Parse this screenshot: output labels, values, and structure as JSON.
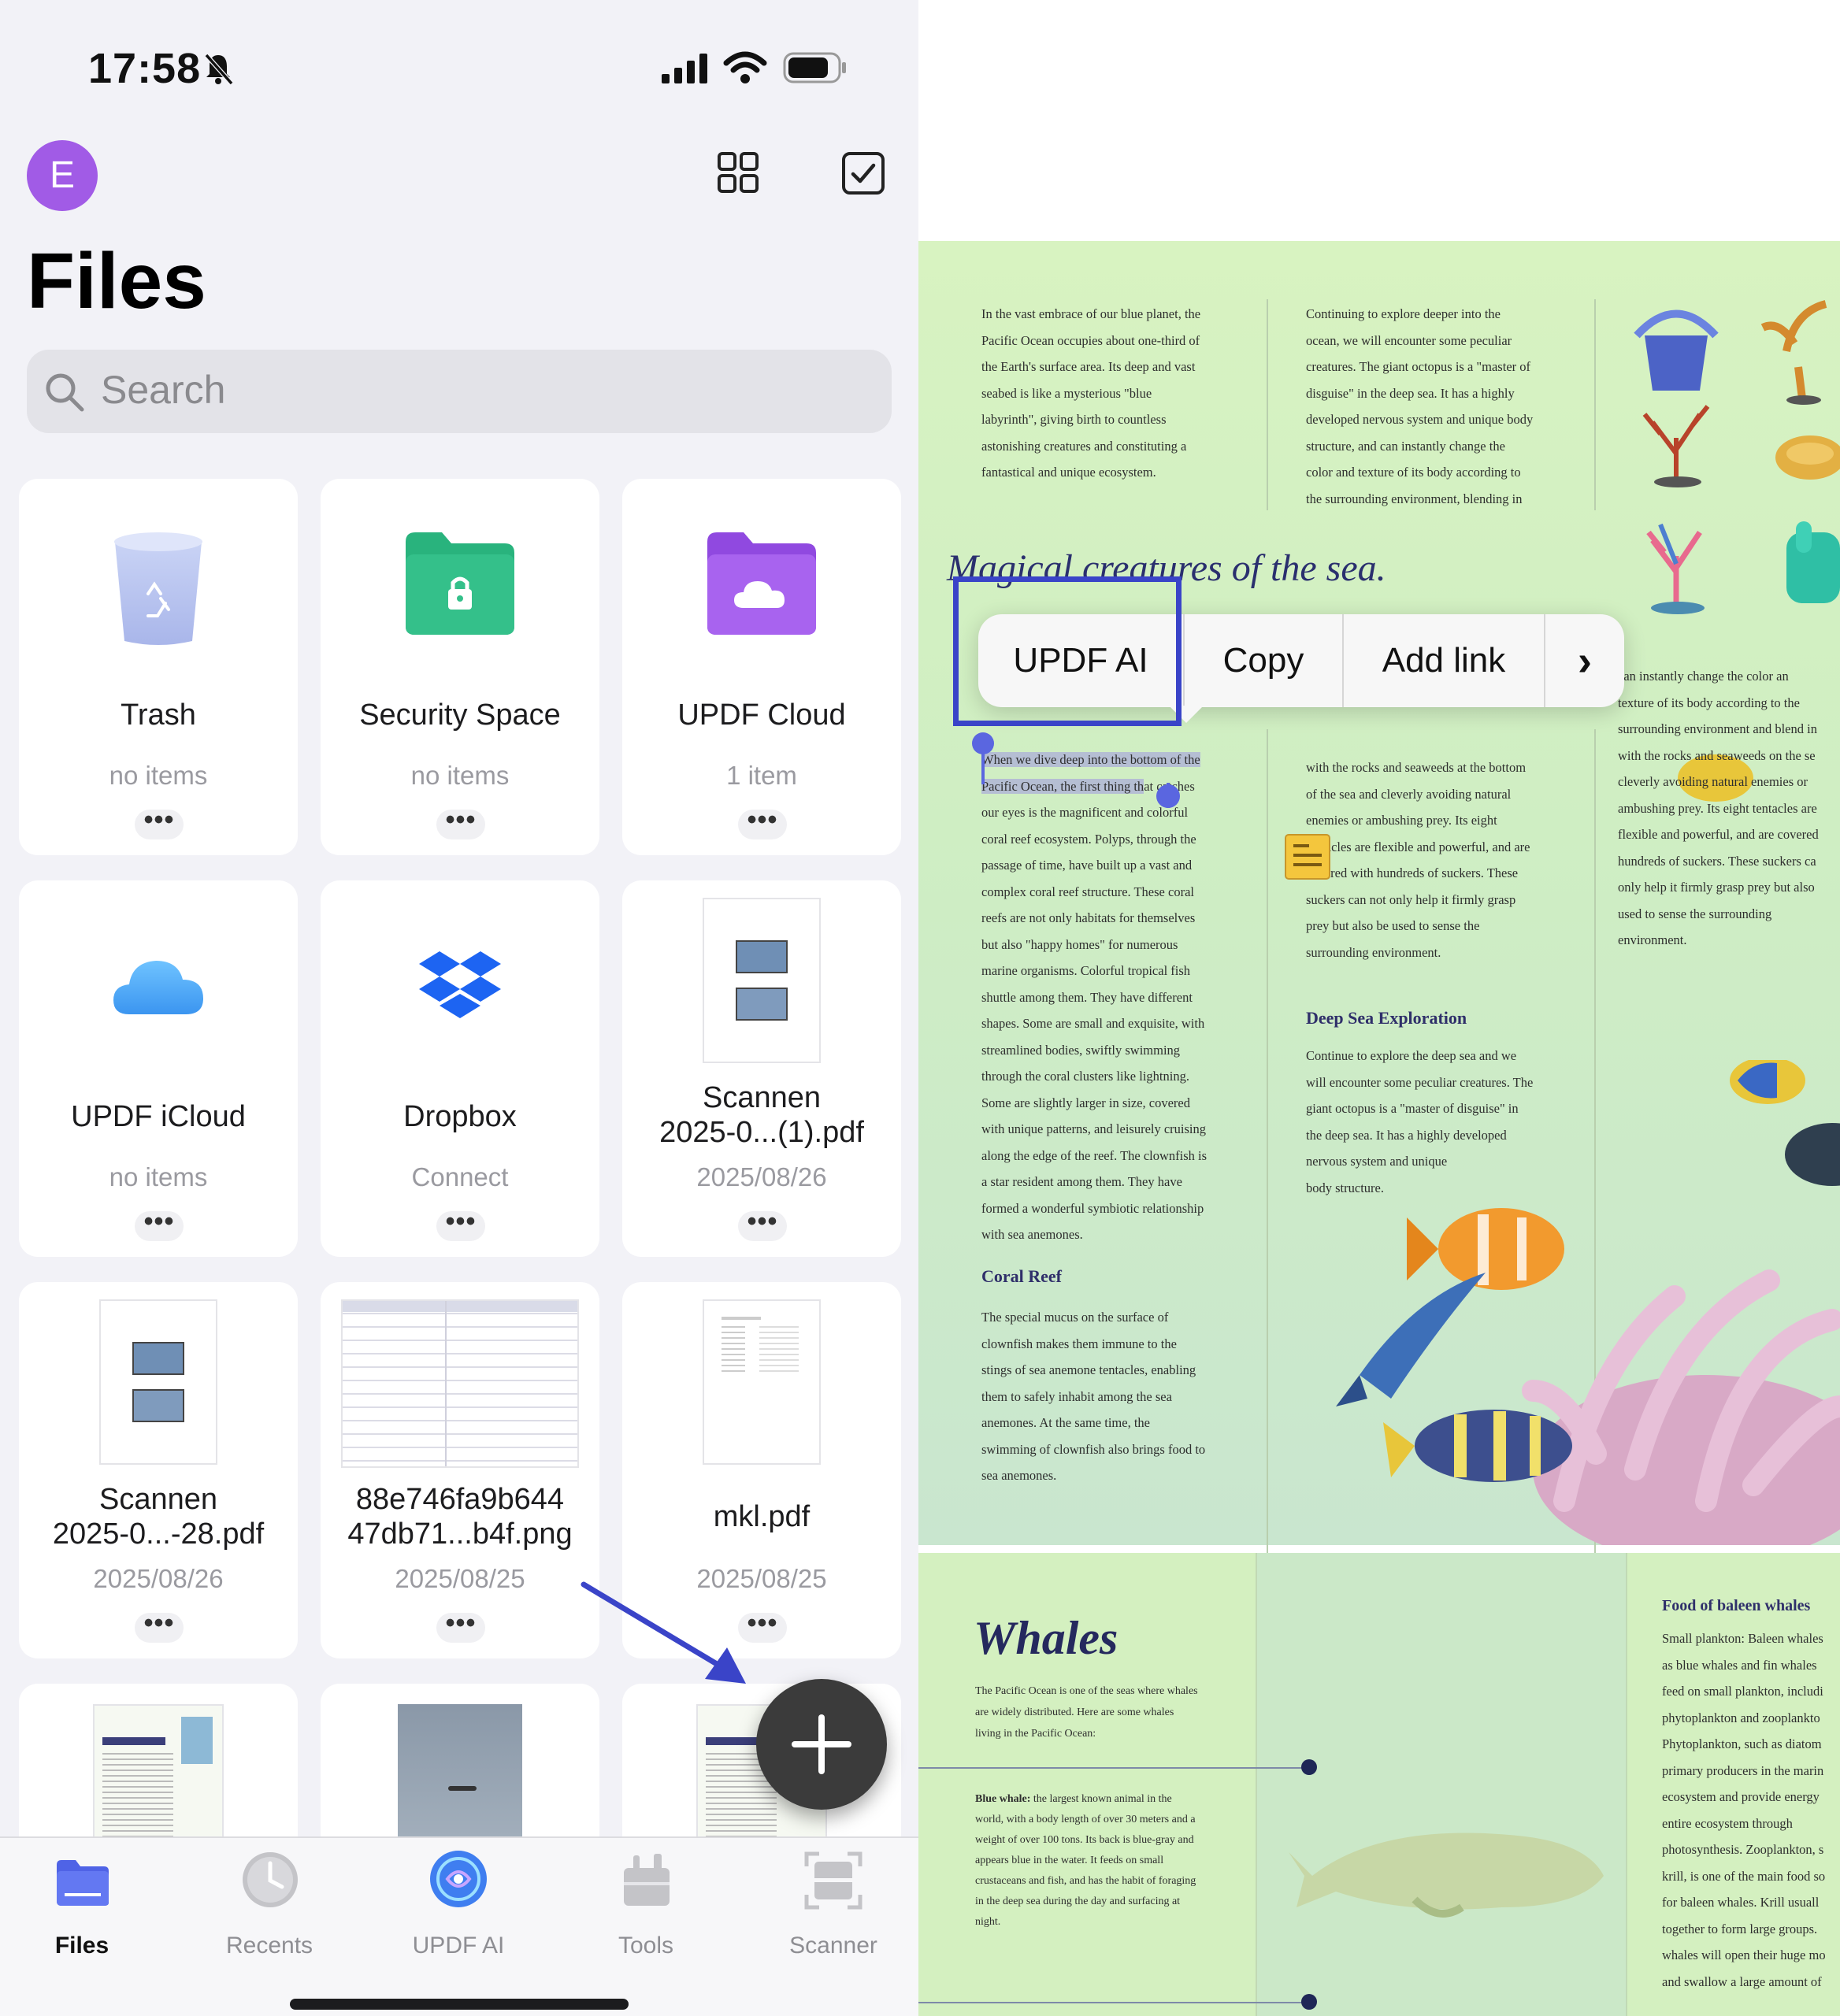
{
  "status_bar": {
    "time": "17:58"
  },
  "header": {
    "avatar_letter": "E",
    "title": "Files"
  },
  "search": {
    "placeholder": "Search"
  },
  "files": [
    {
      "title": "Trash",
      "subtitle": "no items"
    },
    {
      "title": "Security Space",
      "subtitle": "no items"
    },
    {
      "title": "UPDF Cloud",
      "subtitle": "1 item"
    },
    {
      "title": "UPDF iCloud",
      "subtitle": "no items"
    },
    {
      "title": "Dropbox",
      "subtitle": "Connect"
    },
    {
      "title_line1": "Scannen",
      "title_line2": "2025-0...(1).pdf",
      "subtitle": "2025/08/26"
    },
    {
      "title_line1": "Scannen",
      "title_line2": "2025-0...-28.pdf",
      "subtitle": "2025/08/26"
    },
    {
      "title_line1": "88e746fa9b644",
      "title_line2": "47db71...b4f.png",
      "subtitle": "2025/08/25"
    },
    {
      "title": "mkl.pdf",
      "subtitle": "2025/08/25"
    }
  ],
  "more_glyph": "•••",
  "tabs": [
    {
      "label": "Files"
    },
    {
      "label": "Recents"
    },
    {
      "label": "UPDF AI"
    },
    {
      "label": "Tools"
    },
    {
      "label": "Scanner"
    }
  ],
  "context_menu": {
    "ai": "UPDF AI",
    "copy": "Copy",
    "add_link": "Add link",
    "more": "›"
  },
  "colors": {
    "accent": "#4b4bd6",
    "avatar": "#a15be6",
    "security_green": "#2fb57a",
    "cloud_purple": "#a05be8"
  },
  "doc": {
    "col1_top": [
      "In the vast embrace of our blue planet, the",
      "Pacific Ocean occupies about one-third of",
      "the Earth's surface area. Its deep and vast",
      "seabed is like a mysterious \"blue",
      "labyrinth\", giving birth to countless",
      "astonishing creatures and constituting a",
      "fantastical and unique ecosystem."
    ],
    "col2_top": [
      "Continuing to explore deeper into the",
      "ocean, we will encounter some peculiar",
      "creatures. The giant octopus is a \"master of",
      "disguise\" in the deep sea. It has a highly",
      "developed nervous system and unique body",
      "structure, and can instantly change the",
      "color and texture of its body according to",
      "the surrounding environment, blending in"
    ],
    "section_heading": "Magical creatures of the sea.",
    "col1_selected": [
      "When we dive deep into the bottom of the",
      "Pacific Ocean, the first thing th"
    ],
    "col1_selected_rest": "at catches",
    "col1_main": [
      "our eyes is the magnificent and colorful",
      "coral reef ecosystem. Polyps, through the",
      "passage of time, have built up a vast and",
      "complex coral reef structure. These coral",
      "reefs are not only habitats for themselves",
      "but also \"happy homes\" for numerous",
      "marine organisms. Colorful tropical fish",
      "shuttle among them. They have different",
      "shapes. Some are small and exquisite, with",
      "streamlined bodies, swiftly swimming",
      "through the coral clusters like lightning.",
      "Some are slightly larger in size, covered",
      "with unique patterns, and leisurely cruising",
      "along the edge of the reef. The clownfish is",
      "a star resident among them. They have",
      "formed a wonderful symbiotic relationship",
      "with sea anemones."
    ],
    "coral_heading": "Coral Reef",
    "coral_text": [
      " The special mucus on the surface of",
      "clownfish makes them immune to the",
      "stings of sea anemone tentacles, enabling",
      "them to safely inhabit among the sea",
      "anemones. At the same time, the",
      "swimming of clownfish also brings food to",
      "sea anemones."
    ],
    "col2_main": [
      "with the rocks and seaweeds at the bottom",
      "of the sea and cleverly avoiding natural",
      "enemies or ambushing prey. Its eight",
      "tentacles are flexible and powerful, and are",
      "covered with hundreds of suckers. These",
      "suckers can not only help it firmly grasp",
      "prey but also be used to sense the",
      "surrounding environment."
    ],
    "deep_heading": "Deep Sea Exploration",
    "deep_text": [
      "Continue to explore the deep sea and we",
      "will encounter some peculiar creatures. The",
      "giant octopus is a \"master of disguise\" in",
      "the deep sea. It has a highly developed",
      "nervous system and unique",
      "body structure."
    ],
    "col3_main": [
      "can instantly change the color an",
      "texture of its body according to the",
      "surrounding environment and blend in",
      "with the rocks and seaweeds on the se",
      "cleverly avoiding natural enemies or",
      "ambushing prey. Its eight tentacles are",
      "flexible and powerful, and are covered",
      "hundreds of suckers. These suckers ca",
      "only help it firmly grasp prey but also",
      "used to sense the surrounding",
      "environment."
    ],
    "whales_title": "Whales",
    "whales_intro": [
      "The Pacific Ocean is one of the seas where whales",
      "are widely distributed. Here are some whales",
      "living in the Pacific Ocean:"
    ],
    "blue_whale_label": "Blue whale:",
    "blue_whale_text": [
      " the largest known animal in the",
      "world, with a body length of over 30 meters and a",
      "weight of over 100 tons. Its back is blue-gray and",
      "appears blue in the water. It feeds on small",
      "crustaceans and fish, and has the habit of foraging",
      "in the deep sea during the day and surfacing at",
      "night."
    ],
    "baleen_heading": "Food of baleen whales",
    "baleen_text": [
      "Small plankton: Baleen whales",
      "as blue whales and fin whales",
      "feed on small plankton, includi",
      "phytoplankton and zooplankto",
      "Phytoplankton, such as diatom",
      "primary producers in the marin",
      "ecosystem and provide energy",
      "entire ecosystem through",
      "photosynthesis. Zooplankton, s",
      "krill, is one of the main food so",
      "for baleen whales. Krill usuall",
      "together to form large groups.",
      "whales will open their huge mo",
      "and swallow a large amount of"
    ]
  }
}
